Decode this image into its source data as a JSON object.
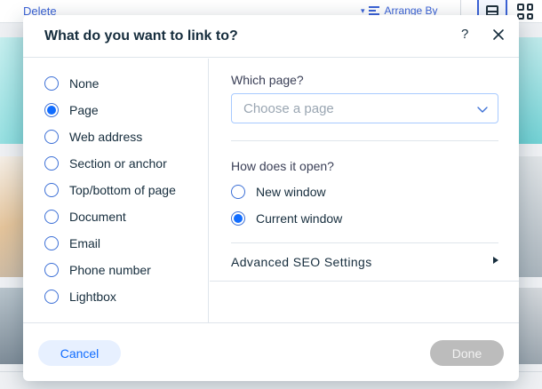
{
  "background": {
    "delete_label": "Delete",
    "arrange_label": "Arrange By"
  },
  "dialog": {
    "title": "What do you want to link to?",
    "help_label": "?",
    "link_types": [
      {
        "label": "None",
        "checked": false
      },
      {
        "label": "Page",
        "checked": true
      },
      {
        "label": "Web address",
        "checked": false
      },
      {
        "label": "Section or anchor",
        "checked": false
      },
      {
        "label": "Top/bottom of page",
        "checked": false
      },
      {
        "label": "Document",
        "checked": false
      },
      {
        "label": "Email",
        "checked": false
      },
      {
        "label": "Phone number",
        "checked": false
      },
      {
        "label": "Lightbox",
        "checked": false
      }
    ],
    "page_section": {
      "label": "Which page?",
      "select_placeholder": "Choose a page"
    },
    "open_section": {
      "label": "How does it open?",
      "options": [
        {
          "label": "New window",
          "checked": false
        },
        {
          "label": "Current window",
          "checked": true
        }
      ]
    },
    "seo_label": "Advanced SEO Settings",
    "cancel_label": "Cancel",
    "done_label": "Done"
  },
  "colors": {
    "accent": "#116dff",
    "done_disabled": "#bcbcbc",
    "cancel_bg": "#e7f0ff"
  }
}
